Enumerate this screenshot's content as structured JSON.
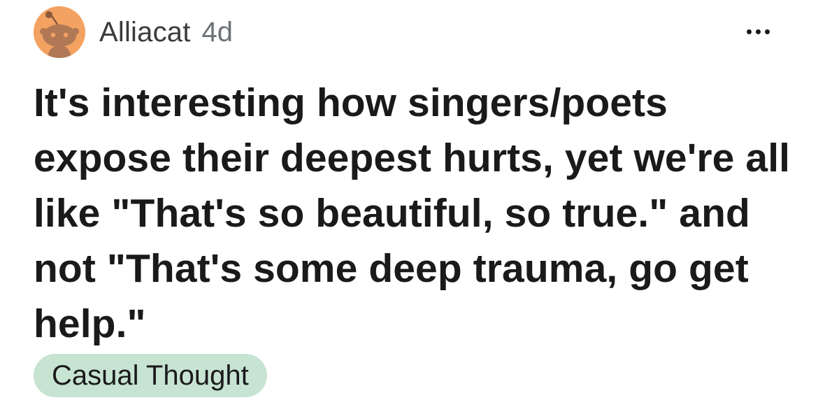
{
  "post": {
    "author": {
      "username": "Alliacat",
      "avatar_icon": "reddit-snoo-avatar-icon",
      "avatar_color": "#f4a261"
    },
    "timestamp": "4d",
    "more_icon": "ellipsis-icon",
    "title": "It's interesting how singers/poets expose their deepest hurts, yet we're all like \"That's so beautiful, so true.\" and not \"That's some deep trauma, go get help.\"",
    "flair": {
      "label": "Casual Thought",
      "color": "#c7e3d2"
    }
  }
}
